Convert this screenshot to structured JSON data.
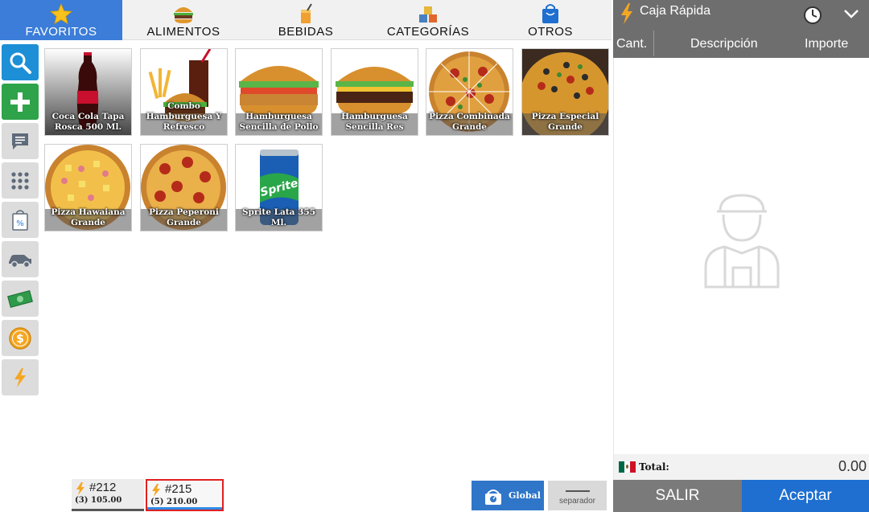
{
  "tabs": [
    {
      "label": "FAVORITOS",
      "icon": "star-icon",
      "active": true
    },
    {
      "label": "ALIMENTOS",
      "icon": "burger-icon",
      "active": false
    },
    {
      "label": "BEBIDAS",
      "icon": "drink-icon",
      "active": false
    },
    {
      "label": "CATEGORÍAS",
      "icon": "categories-icon",
      "active": false
    },
    {
      "label": "OTROS",
      "icon": "bag-icon",
      "active": false
    }
  ],
  "sidebar": [
    {
      "name": "search-button",
      "icon": "magnifier-icon",
      "color": "#1d8fd6"
    },
    {
      "name": "add-button",
      "icon": "plus-icon",
      "color": "#2ea34a"
    },
    {
      "name": "note-button",
      "icon": "comment-icon",
      "color": "#dcdcdc"
    },
    {
      "name": "keypad-button",
      "icon": "keypad-icon",
      "color": "#dcdcdc"
    },
    {
      "name": "discount-button",
      "icon": "bag-percent-icon",
      "color": "#dcdcdc"
    },
    {
      "name": "delivery-button",
      "icon": "car-icon",
      "color": "#dcdcdc"
    },
    {
      "name": "cash-button",
      "icon": "money-icon",
      "color": "#dcdcdc"
    },
    {
      "name": "coin-button",
      "icon": "coin-icon",
      "color": "#dcdcdc"
    },
    {
      "name": "quick-sale-button",
      "icon": "bolt-icon",
      "color": "#dcdcdc"
    }
  ],
  "products": [
    {
      "name": "Coca Cola Tapa Rosca 500 Ml.",
      "image": "cola-bottle"
    },
    {
      "name": "Combo Hamburguesa Y Refresco",
      "image": "combo"
    },
    {
      "name": "Hamburguesa Sencilla de Pollo",
      "image": "burger-chicken"
    },
    {
      "name": "Hamburguesa Sencilla Res",
      "image": "burger-beef"
    },
    {
      "name": "Pizza Combinada Grande",
      "image": "pizza-combo"
    },
    {
      "name": "Pizza Especial Grande",
      "image": "pizza-special"
    },
    {
      "name": "Pizza Hawaiana Grande",
      "image": "pizza-hawaiian"
    },
    {
      "name": "Pizza Peperoni Grande",
      "image": "pizza-pepperoni"
    },
    {
      "name": "Sprite Lata 355 Ml.",
      "image": "sprite-can"
    }
  ],
  "right_panel": {
    "title": "Caja Rápida",
    "columns": {
      "qty": "Cant.",
      "desc": "Descripción",
      "amount": "Importe"
    },
    "total_label": "Total:",
    "total_value": "0.00",
    "cancel_label": "SALIR",
    "accept_label": "Aceptar"
  },
  "tickets": [
    {
      "number": "#212",
      "count": "(3)",
      "amount": "105.00",
      "selected": false
    },
    {
      "number": "#215",
      "count": "(5)",
      "amount": "210.00",
      "selected": true
    }
  ],
  "footer": {
    "global_label": "Global",
    "separator_label": "separador"
  },
  "colors": {
    "accent_blue": "#3b7dd8",
    "accept_blue": "#1e6fd0",
    "header_gray": "#6e6e6e",
    "bolt_orange": "#f5a623"
  }
}
